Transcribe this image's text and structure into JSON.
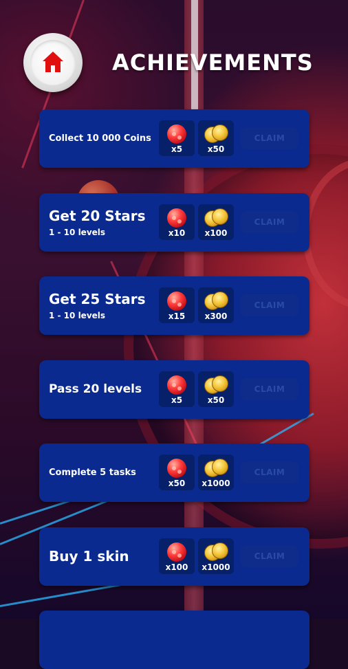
{
  "header": {
    "title": "ACHIEVEMENTS",
    "home_icon": "home-icon"
  },
  "colors": {
    "card": "#0b2a8f",
    "reward_box": "#06206a",
    "claim_disabled_text": "#2a4aa8",
    "home_icon": "#e01010"
  },
  "achievements": [
    {
      "name": "Collect 10 000 Coins",
      "subtitle": "",
      "gems": "x5",
      "coins": "x50",
      "claim": "CLAIM"
    },
    {
      "name": "Get 20 Stars",
      "subtitle": "1 - 10 levels",
      "gems": "x10",
      "coins": "x100",
      "claim": "CLAIM"
    },
    {
      "name": "Get 25 Stars",
      "subtitle": "1 - 10 levels",
      "gems": "x15",
      "coins": "x300",
      "claim": "CLAIM"
    },
    {
      "name": "Pass 20 levels",
      "subtitle": "",
      "gems": "x5",
      "coins": "x50",
      "claim": "CLAIM"
    },
    {
      "name": "Complete 5 tasks",
      "subtitle": "",
      "gems": "x50",
      "coins": "x1000",
      "claim": "CLAIM"
    },
    {
      "name": "Buy 1 skin",
      "subtitle": "",
      "gems": "x100",
      "coins": "x1000",
      "claim": "CLAIM"
    }
  ]
}
